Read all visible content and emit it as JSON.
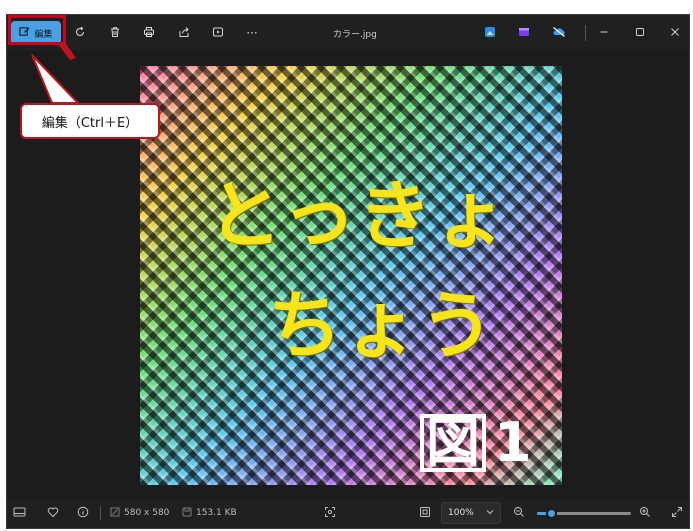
{
  "toolbar": {
    "edit_label": "編集",
    "file_title": "カラー.jpg",
    "icons": [
      "rotate-icon",
      "delete-icon",
      "print-icon",
      "share-icon",
      "slideshow-icon",
      "more-icon"
    ],
    "app_icons": [
      "photos-icon",
      "clipchamp-icon",
      "onedrive-icon"
    ],
    "more_label": "···"
  },
  "tooltip": {
    "text": "編集（Ctrl＋E）"
  },
  "photo": {
    "line1": "とっきょ",
    "line2": "ちょう",
    "fig_char": "図",
    "fig_num": "1"
  },
  "status": {
    "dimensions": "580 x 580",
    "file_size": "153.1 KB",
    "zoom": "100%",
    "zoom_level": 0.15
  },
  "colors": {
    "accent": "#4b9fe3",
    "highlight": "#d0021b"
  }
}
